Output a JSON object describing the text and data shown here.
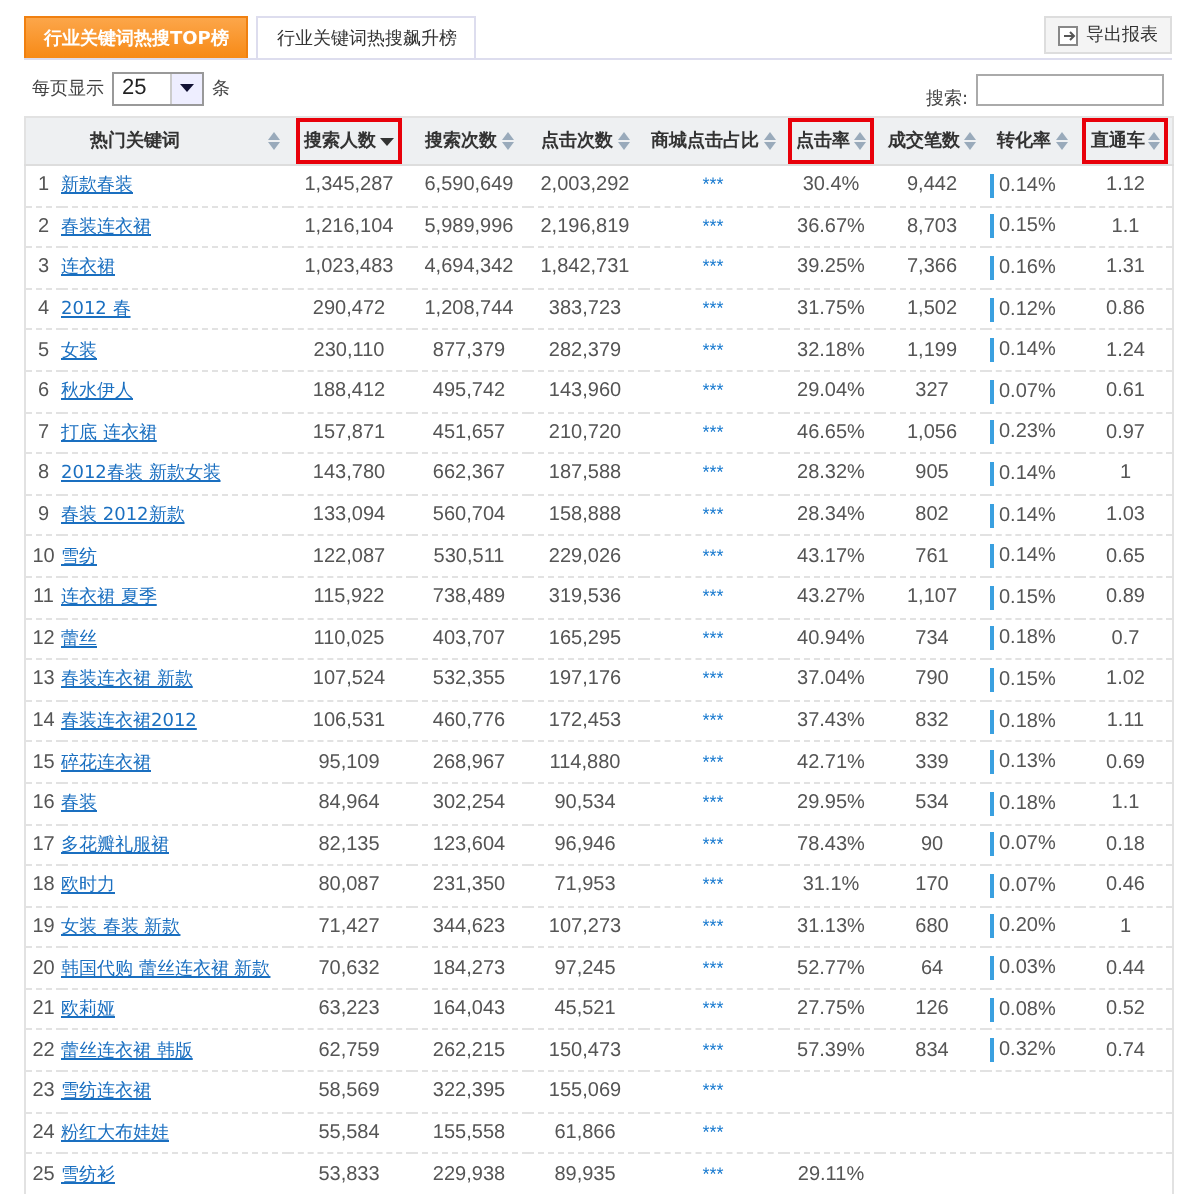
{
  "tabs": [
    {
      "label": "行业关键词热搜TOP榜",
      "selected": true
    },
    {
      "label": "行业关键词热搜飙升榜",
      "selected": false
    }
  ],
  "export_button": "导出报表",
  "page_size": {
    "label": "每页显示",
    "value": "25",
    "unit": "条"
  },
  "search": {
    "label": "搜索:"
  },
  "table": {
    "columns": [
      {
        "label": "热门关键词",
        "highlighted": false,
        "sorted": false
      },
      {
        "label": "搜索人数",
        "highlighted": true,
        "sorted": true
      },
      {
        "label": "搜索次数",
        "highlighted": false,
        "sorted": false
      },
      {
        "label": "点击次数",
        "highlighted": false,
        "sorted": false
      },
      {
        "label": "商城点击占比",
        "highlighted": false,
        "sorted": false
      },
      {
        "label": "点击率",
        "highlighted": true,
        "sorted": false
      },
      {
        "label": "成交笔数",
        "highlighted": false,
        "sorted": false
      },
      {
        "label": "转化率",
        "highlighted": false,
        "sorted": false
      },
      {
        "label": "直通车",
        "highlighted": true,
        "sorted": false
      }
    ],
    "rows": [
      {
        "rank": "1",
        "cells": [
          "新款春装",
          "1,345,287",
          "6,590,649",
          "2,003,292",
          "***",
          "30.4%",
          "9,442",
          "0.14%",
          "1.12"
        ]
      },
      {
        "rank": "2",
        "cells": [
          "春装连衣裙",
          "1,216,104",
          "5,989,996",
          "2,196,819",
          "***",
          "36.67%",
          "8,703",
          "0.15%",
          "1.1"
        ]
      },
      {
        "rank": "3",
        "cells": [
          "连衣裙",
          "1,023,483",
          "4,694,342",
          "1,842,731",
          "***",
          "39.25%",
          "7,366",
          "0.16%",
          "1.31"
        ]
      },
      {
        "rank": "4",
        "cells": [
          "2012 春",
          "290,472",
          "1,208,744",
          "383,723",
          "***",
          "31.75%",
          "1,502",
          "0.12%",
          "0.86"
        ]
      },
      {
        "rank": "5",
        "cells": [
          "女装",
          "230,110",
          "877,379",
          "282,379",
          "***",
          "32.18%",
          "1,199",
          "0.14%",
          "1.24"
        ]
      },
      {
        "rank": "6",
        "cells": [
          "秋水伊人",
          "188,412",
          "495,742",
          "143,960",
          "***",
          "29.04%",
          "327",
          "0.07%",
          "0.61"
        ]
      },
      {
        "rank": "7",
        "cells": [
          "打底 连衣裙",
          "157,871",
          "451,657",
          "210,720",
          "***",
          "46.65%",
          "1,056",
          "0.23%",
          "0.97"
        ]
      },
      {
        "rank": "8",
        "cells": [
          "2012春装 新款女装",
          "143,780",
          "662,367",
          "187,588",
          "***",
          "28.32%",
          "905",
          "0.14%",
          "1"
        ]
      },
      {
        "rank": "9",
        "cells": [
          "春装 2012新款",
          "133,094",
          "560,704",
          "158,888",
          "***",
          "28.34%",
          "802",
          "0.14%",
          "1.03"
        ]
      },
      {
        "rank": "10",
        "cells": [
          "雪纺",
          "122,087",
          "530,511",
          "229,026",
          "***",
          "43.17%",
          "761",
          "0.14%",
          "0.65"
        ]
      },
      {
        "rank": "11",
        "cells": [
          "连衣裙 夏季",
          "115,922",
          "738,489",
          "319,536",
          "***",
          "43.27%",
          "1,107",
          "0.15%",
          "0.89"
        ]
      },
      {
        "rank": "12",
        "cells": [
          "蕾丝",
          "110,025",
          "403,707",
          "165,295",
          "***",
          "40.94%",
          "734",
          "0.18%",
          "0.7"
        ]
      },
      {
        "rank": "13",
        "cells": [
          "春装连衣裙 新款",
          "107,524",
          "532,355",
          "197,176",
          "***",
          "37.04%",
          "790",
          "0.15%",
          "1.02"
        ]
      },
      {
        "rank": "14",
        "cells": [
          "春装连衣裙2012",
          "106,531",
          "460,776",
          "172,453",
          "***",
          "37.43%",
          "832",
          "0.18%",
          "1.11"
        ]
      },
      {
        "rank": "15",
        "cells": [
          "碎花连衣裙",
          "95,109",
          "268,967",
          "114,880",
          "***",
          "42.71%",
          "339",
          "0.13%",
          "0.69"
        ]
      },
      {
        "rank": "16",
        "cells": [
          "春装",
          "84,964",
          "302,254",
          "90,534",
          "***",
          "29.95%",
          "534",
          "0.18%",
          "1.1"
        ]
      },
      {
        "rank": "17",
        "cells": [
          "多花瓣礼服裙",
          "82,135",
          "123,604",
          "96,946",
          "***",
          "78.43%",
          "90",
          "0.07%",
          "0.18"
        ]
      },
      {
        "rank": "18",
        "cells": [
          "欧时力",
          "80,087",
          "231,350",
          "71,953",
          "***",
          "31.1%",
          "170",
          "0.07%",
          "0.46"
        ]
      },
      {
        "rank": "19",
        "cells": [
          "女装 春装 新款",
          "71,427",
          "344,623",
          "107,273",
          "***",
          "31.13%",
          "680",
          "0.20%",
          "1"
        ]
      },
      {
        "rank": "20",
        "cells": [
          "韩国代购 蕾丝连衣裙 新款",
          "70,632",
          "184,273",
          "97,245",
          "***",
          "52.77%",
          "64",
          "0.03%",
          "0.44"
        ]
      },
      {
        "rank": "21",
        "cells": [
          "欧莉娅",
          "63,223",
          "164,043",
          "45,521",
          "***",
          "27.75%",
          "126",
          "0.08%",
          "0.52"
        ]
      },
      {
        "rank": "22",
        "cells": [
          "蕾丝连衣裙 韩版",
          "62,759",
          "262,215",
          "150,473",
          "***",
          "57.39%",
          "834",
          "0.32%",
          "0.74"
        ]
      },
      {
        "rank": "23",
        "cells": [
          "雪纺连衣裙",
          "58,569",
          "322,395",
          "155,069",
          "***"
        ]
      },
      {
        "rank": "24",
        "cells": [
          "粉红大布娃娃",
          "55,584",
          "155,558",
          "61,866",
          "***"
        ]
      },
      {
        "rank": "25",
        "cells": [
          "雪纺衫",
          "53,833",
          "229,938",
          "89,935",
          "***",
          "29.11%"
        ]
      }
    ]
  }
}
